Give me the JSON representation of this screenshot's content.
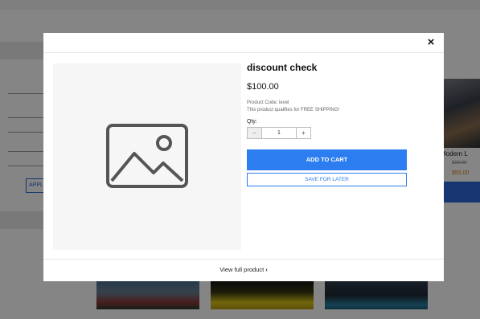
{
  "background": {
    "apply_label": "APPLY",
    "product_title": "Modern L",
    "product_old_price": "$89.99",
    "product_price": "$55.00"
  },
  "modal": {
    "close_symbol": "×",
    "product": {
      "title": "discount check",
      "price": "$100.00",
      "code_line": "Product Code: level",
      "shipping_line": "This product qualifies for FREE SHIPPING!",
      "image_icon": "image-placeholder-icon"
    },
    "quantity": {
      "label": "Qty:",
      "value": "1",
      "minus": "−",
      "plus": "+"
    },
    "buttons": {
      "add_to_cart": "ADD TO CART",
      "save_for_later": "SAVE FOR LATER"
    },
    "footer": {
      "view_full": "View full product",
      "chevron": "›"
    }
  },
  "colors": {
    "accent": "#2c7df0",
    "overlay": "rgba(0,0,0,0.48)"
  }
}
